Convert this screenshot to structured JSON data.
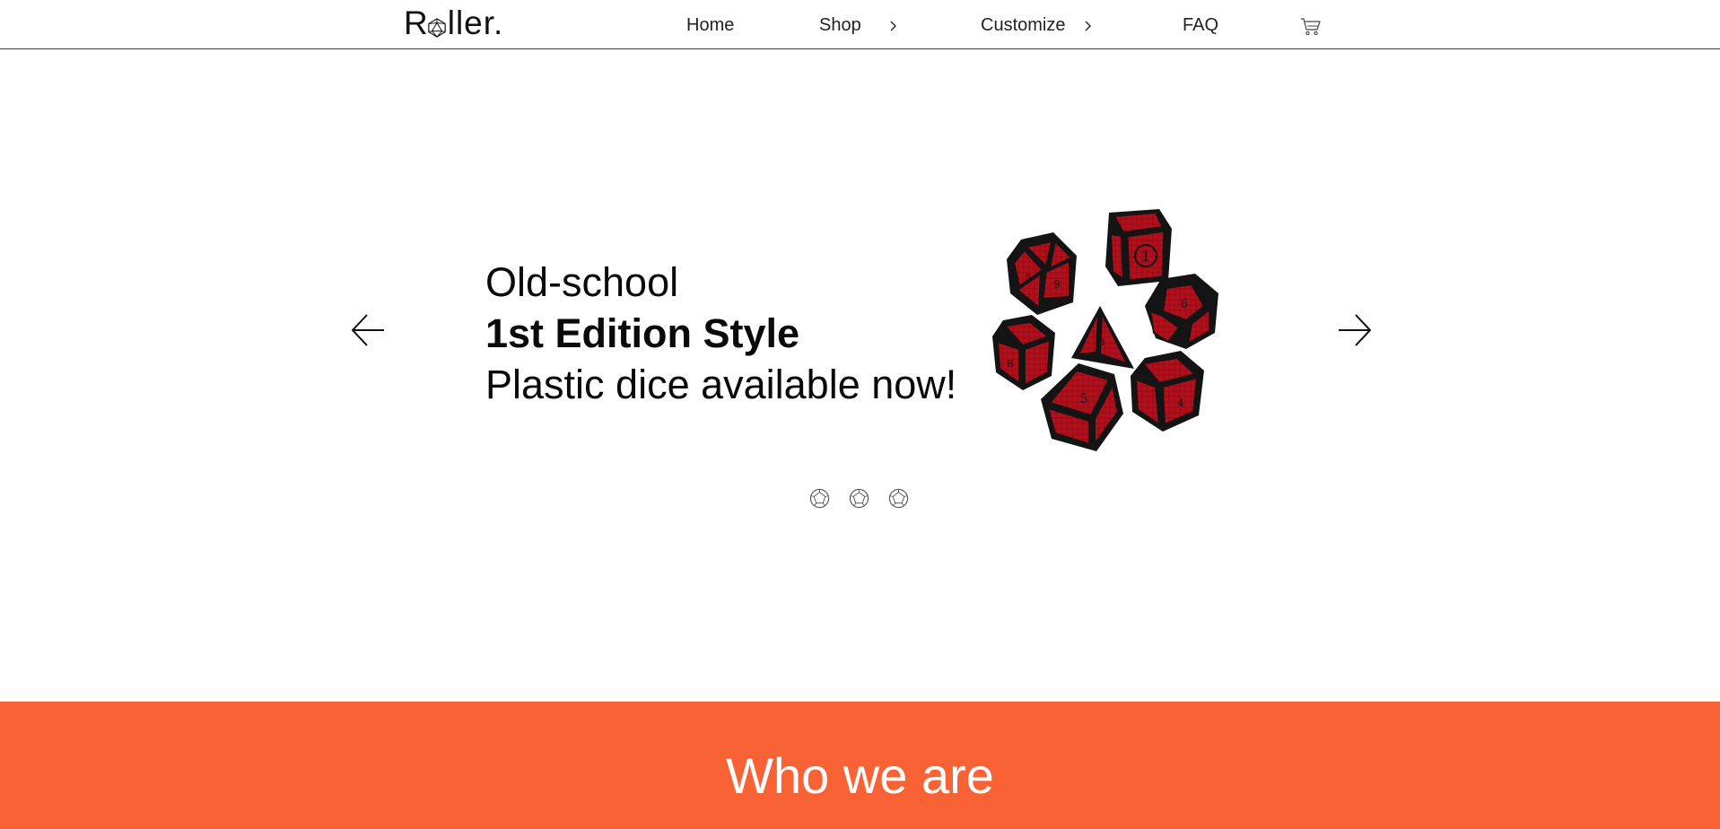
{
  "brand": {
    "logo_first": "R",
    "logo_rest": "ller.",
    "logo_icon": "d20-die-icon"
  },
  "nav": {
    "items": [
      {
        "label": "Home",
        "has_submenu": false
      },
      {
        "label": "Shop",
        "has_submenu": true
      },
      {
        "label": "Customize",
        "has_submenu": true
      },
      {
        "label": "FAQ",
        "has_submenu": false
      }
    ],
    "cart_icon": "shopping-cart-icon"
  },
  "hero": {
    "line1": "Old-school",
    "line2": "1st Edition Style",
    "line3": "Plastic dice available now!",
    "image_alt": "Set of seven black and red polyhedral dice",
    "prev_icon": "arrow-left-icon",
    "next_icon": "arrow-right-icon",
    "slides_count": 3,
    "active_slide": 1
  },
  "section": {
    "title": "Who we are"
  },
  "colors": {
    "accent": "#f96235",
    "text": "#111111",
    "background": "#ffffff",
    "dice_red": "#b3101c",
    "dice_black": "#141414"
  }
}
